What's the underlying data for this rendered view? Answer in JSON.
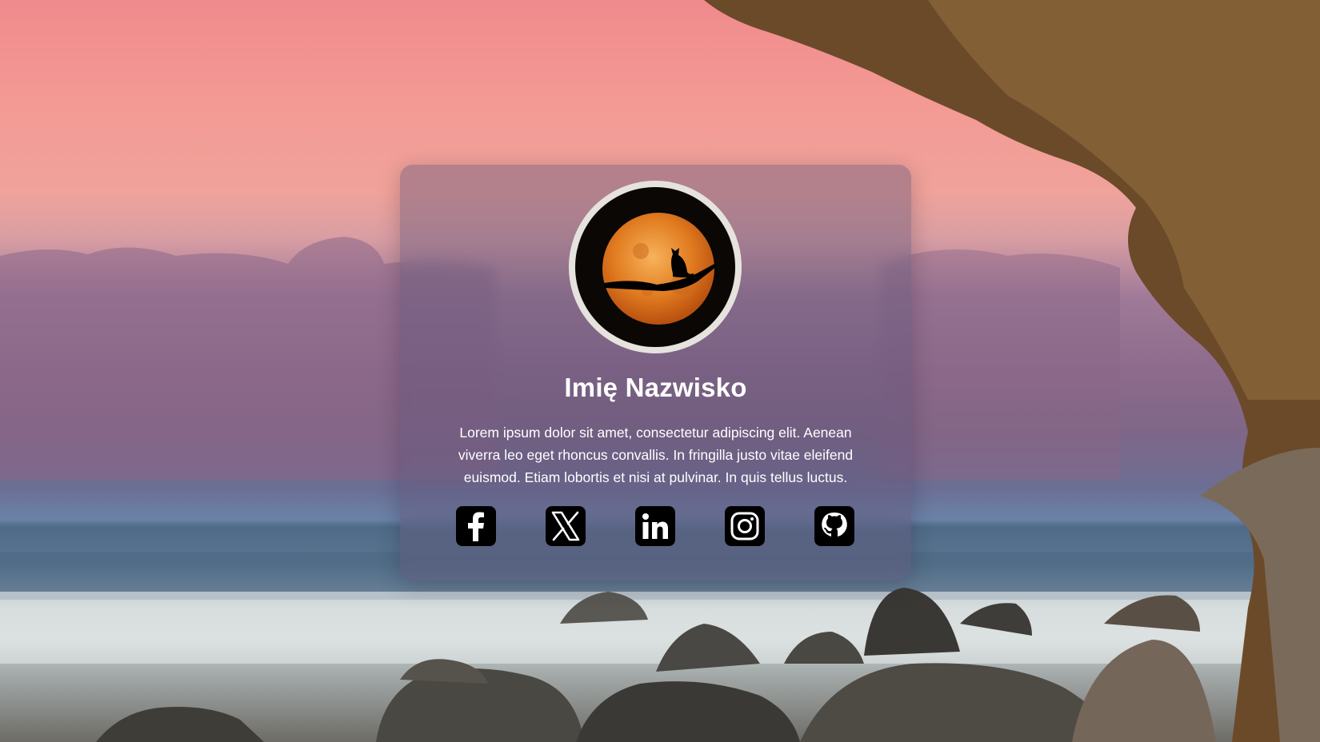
{
  "profile": {
    "name": "Imię Nazwisko",
    "bio": "Lorem ipsum dolor sit amet, consectetur adipiscing elit. Aenean viverra leo eget rhoncus convallis. In fringilla justo vitae eleifend euismod. Etiam lobortis et nisi at pulvinar. In quis tellus luctus.",
    "avatar_icon": "cat-on-branch-full-moon"
  },
  "socials": [
    {
      "icon": "facebook-icon"
    },
    {
      "icon": "x-twitter-icon"
    },
    {
      "icon": "linkedin-icon"
    },
    {
      "icon": "instagram-icon"
    },
    {
      "icon": "github-icon"
    }
  ],
  "colors": {
    "card_tint": "#5f5476",
    "text": "#ffffff",
    "icon_background": "#000000",
    "moon": "#e07a1f"
  }
}
